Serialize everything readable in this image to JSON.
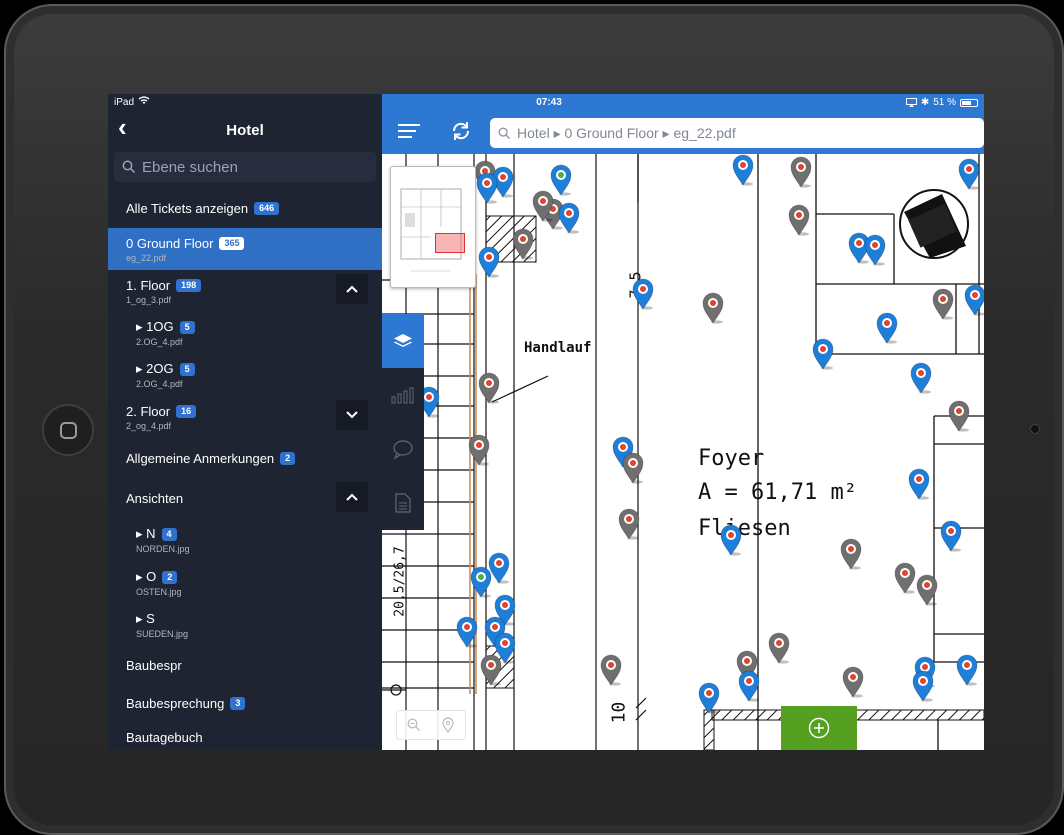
{
  "status": {
    "device": "iPad",
    "time": "07:43",
    "battery": "51 %"
  },
  "sidebar": {
    "title": "Hotel",
    "search_placeholder": "Ebene suchen",
    "items": [
      {
        "label": "Alle Tickets anzeigen",
        "badge": "646"
      },
      {
        "label": "0 Ground Floor",
        "badge": "365",
        "file": "eg_22.pdf",
        "selected": true
      },
      {
        "label": "1. Floor",
        "badge": "198",
        "file": "1_og_3.pdf",
        "expand": "up"
      },
      {
        "label": "▸ 1OG",
        "badge": "5",
        "file": "2.OG_4.pdf"
      },
      {
        "label": "▸ 2OG",
        "badge": "5",
        "file": "2.OG_4.pdf"
      },
      {
        "label": "2. Floor",
        "badge": "16",
        "file": "2_og_4.pdf",
        "expand": "down"
      },
      {
        "label": "Allgemeine Anmerkungen",
        "badge": "2"
      },
      {
        "label": "Ansichten",
        "expand": "up"
      },
      {
        "label": "▸ N",
        "badge": "4",
        "file": "NORDEN.jpg"
      },
      {
        "label": "▸ O",
        "badge": "2",
        "file": "OSTEN.jpg"
      },
      {
        "label": "▸ S",
        "file": "SUEDEN.jpg"
      },
      {
        "label": "Baubespr"
      },
      {
        "label": "Baubesprechung",
        "badge": "3"
      },
      {
        "label": "Bautagebuch"
      }
    ]
  },
  "topbar": {
    "path": "Hotel ▸ 0 Ground Floor ▸ eg_22.pdf"
  },
  "plan": {
    "room_name": "Foyer",
    "room_area": "A = 61,71 m²",
    "room_floor": "Fliesen",
    "label_handlauf": "Handlauf",
    "label_vertical_1": "20,5/26,7",
    "label_vertical_2": "10",
    "label_vertical_3": "7,5",
    "pin_colors": {
      "blue": "#1f7fd8",
      "gray": "#6f6f6f",
      "dot_red": "#e0442e",
      "dot_green": "#4cb050"
    }
  },
  "colors": {
    "accent": "#2d78d3",
    "sidebar_bg": "#1f2432",
    "add_button": "#55a020"
  }
}
